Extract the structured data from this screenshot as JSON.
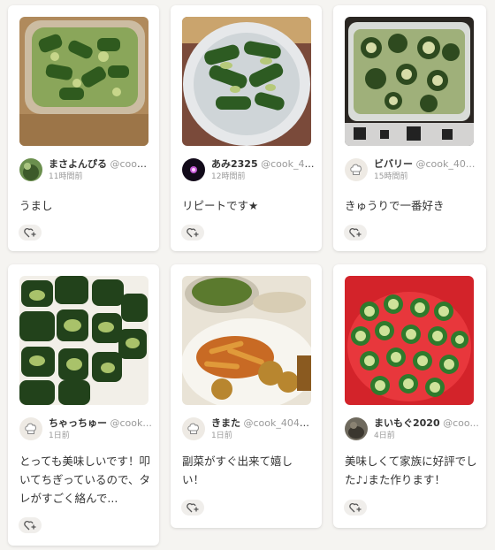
{
  "cards": [
    {
      "author": "まさよんぴる",
      "handle": "@cook_...",
      "time": "11時間前",
      "comment": "うまし"
    },
    {
      "author": "あみ2325",
      "handle": "@cook_40...",
      "time": "12時間前",
      "comment": "リピートです★"
    },
    {
      "author": "ビバリー",
      "handle": "@cook_40...",
      "time": "15時間前",
      "comment": "きゅうりで一番好き"
    },
    {
      "author": "ちゃっちゅー",
      "handle": "@cook...",
      "time": "1日前",
      "comment": "とっても美味しいです！叩いてちぎっているので、タレがすごく絡んで..."
    },
    {
      "author": "きまた",
      "handle": "@cook_4040...",
      "time": "1日前",
      "comment": "副菜がすぐ出来て嬉しい！"
    },
    {
      "author": "まいもぐ2020",
      "handle": "@coo...",
      "time": "4日前",
      "comment": "美味しくて家族に好評でした♪♩また作ります！"
    }
  ]
}
